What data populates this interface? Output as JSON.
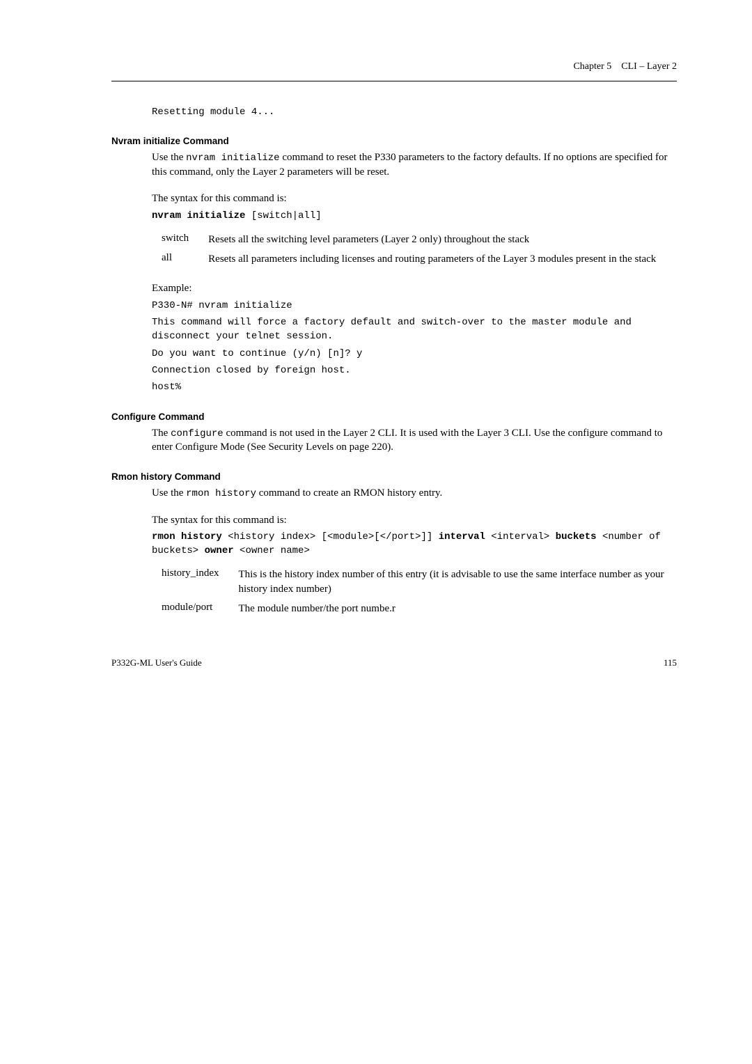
{
  "header": {
    "chapter": "Chapter 5",
    "title": "CLI – Layer 2"
  },
  "code_reset": "Resetting module 4...",
  "sections": {
    "nvram": {
      "title": "Nvram initialize Command",
      "para1a": "Use the ",
      "para1code": "nvram initialize",
      "para1b": " command to reset the P330 parameters to the factory defaults. If no options are specified for this command, only the Layer 2 parameters will be reset.",
      "syntax_label": "The syntax for this command is:",
      "syntax_cmd_bold": "nvram initialize",
      "syntax_cmd_rest": " [switch|all]",
      "opts": [
        {
          "term": "switch",
          "desc": "Resets all the switching level parameters (Layer 2 only) throughout the stack"
        },
        {
          "term": "all",
          "desc": "Resets all parameters including licenses and routing parameters of the Layer 3 modules present in the stack"
        }
      ],
      "example_label": "Example:",
      "example_lines": [
        "P330-N# nvram initialize",
        "This command will force a factory default and switch-over to the master module and disconnect your telnet session.",
        "Do you want to continue (y/n) [n]? y",
        "Connection closed by foreign host.",
        "host%"
      ]
    },
    "configure": {
      "title": "Configure Command",
      "para_a": "The ",
      "para_code": "configure",
      "para_b": " command is not used in the Layer 2 CLI. It is used with the Layer 3 CLI. Use the configure command to enter Configure Mode (See Security Levels on page 220)."
    },
    "rmon": {
      "title": "Rmon history Command",
      "para_a": "Use the ",
      "para_code": "rmon history",
      "para_b": " command to create an RMON history entry.",
      "syntax_label": "The syntax for this command is:",
      "syntax_parts": {
        "p1": "rmon history",
        "p2": " <history index> [<module>[</port>]] ",
        "p3": "interval",
        "p4": " <interval> ",
        "p5": "buckets",
        "p6": " <number of buckets> ",
        "p7": "owner",
        "p8": " <owner name>"
      },
      "opts": [
        {
          "term": "history_index",
          "desc": "This is the history index number of this entry (it is advisable to use the same interface number as your history index number)"
        },
        {
          "term": "module/port",
          "desc": "The module number/the port numbe.r"
        }
      ]
    }
  },
  "footer": {
    "left": "P332G-ML User's Guide",
    "right": "115"
  }
}
